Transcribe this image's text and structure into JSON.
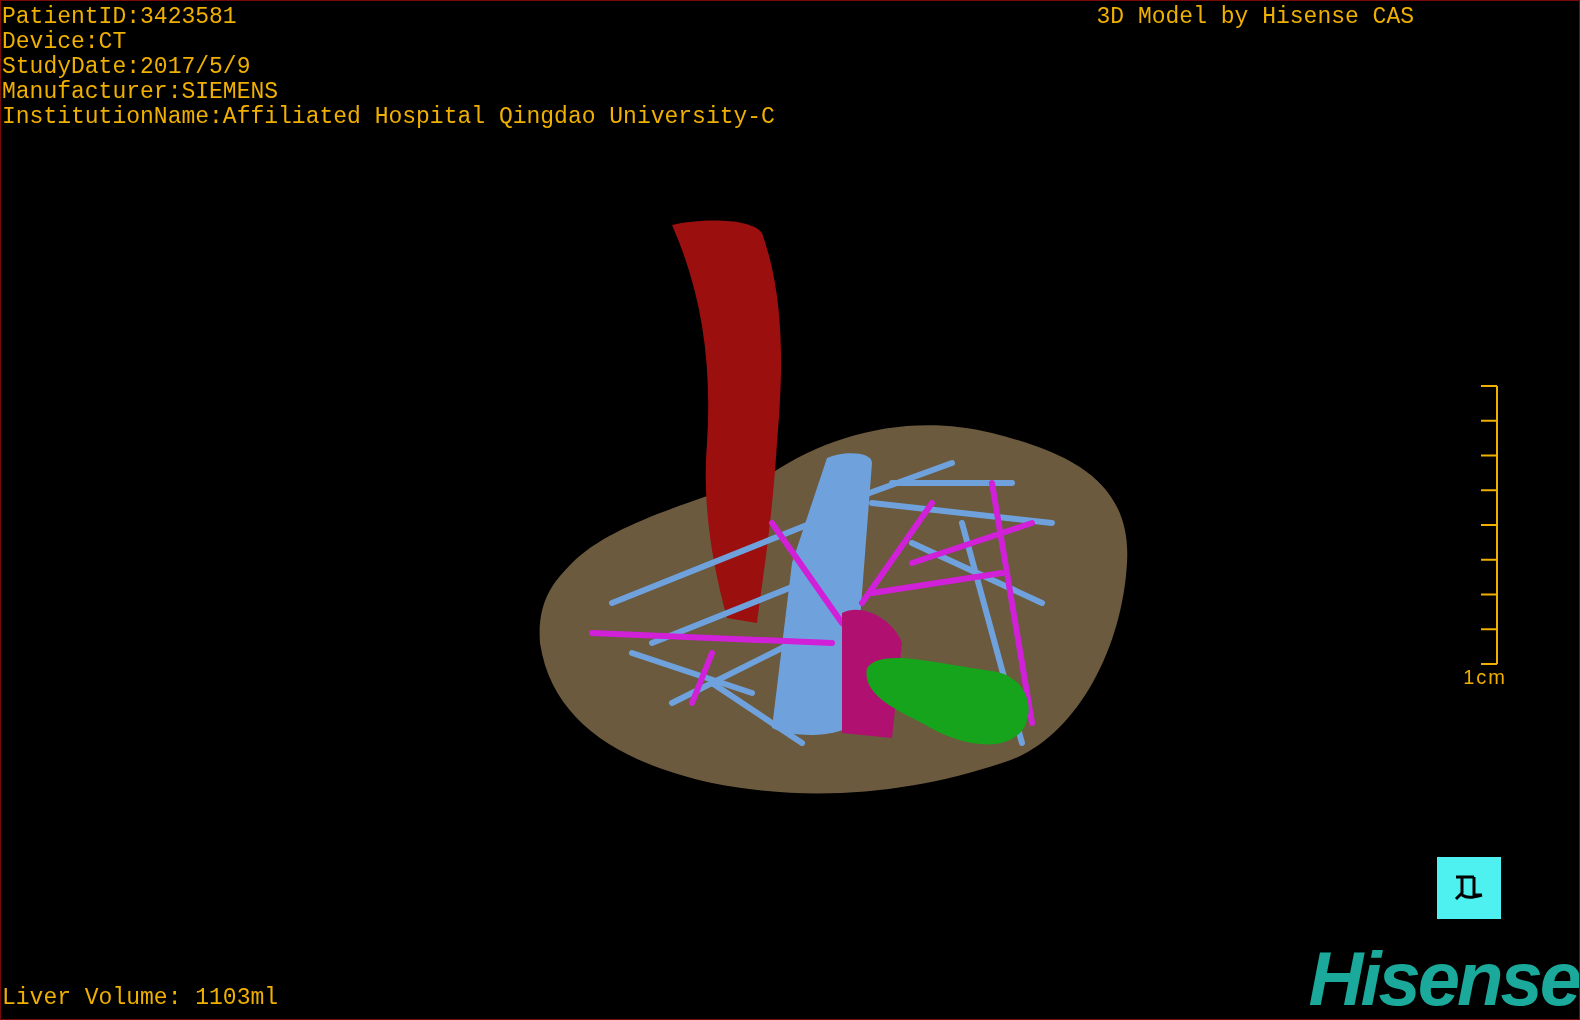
{
  "study_info": [
    "PatientID:3423581",
    "Device:CT",
    "StudyDate:2017/5/9",
    "Manufacturer:SIEMENS",
    "InstitutionName:Affiliated Hospital Qingdao University-C"
  ],
  "title": "3D Model by Hisense CAS",
  "scale_bar": {
    "label": "1cm"
  },
  "liver_volume": "Liver Volume: 1103ml",
  "logo": "Hisense"
}
